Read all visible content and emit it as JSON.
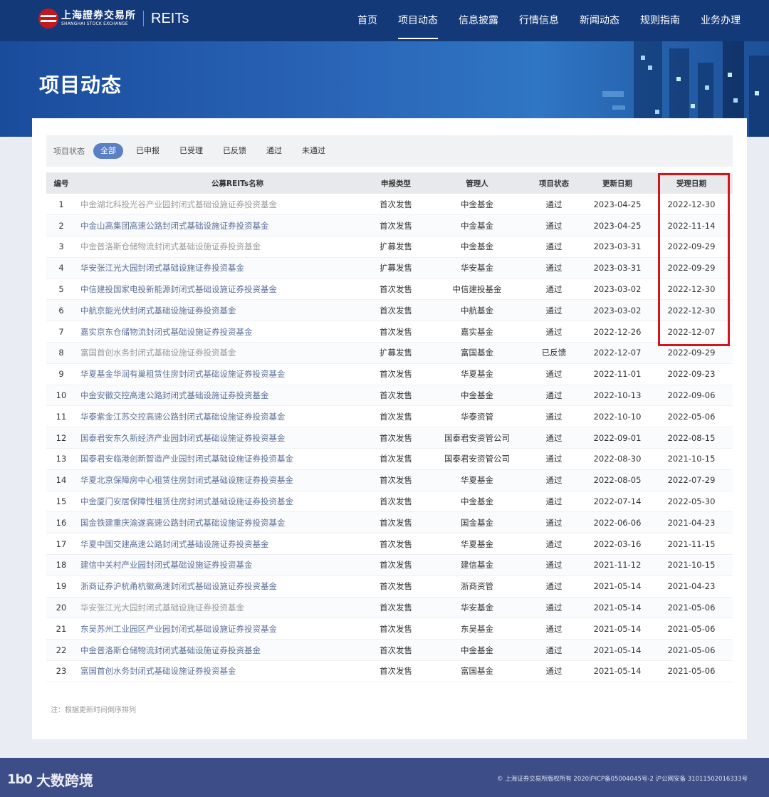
{
  "header": {
    "logo_cn": "上海證券交易所",
    "logo_en": "SHANGHAI STOCK EXCHANGE",
    "logo_reits": "REITs",
    "nav": [
      "首页",
      "项目动态",
      "信息披露",
      "行情信息",
      "新闻动态",
      "规则指南",
      "业务办理"
    ]
  },
  "banner": {
    "title": "项目动态"
  },
  "filter": {
    "label": "项目状态",
    "options": [
      "全部",
      "已申报",
      "已受理",
      "已反馈",
      "通过",
      "未通过"
    ],
    "active": "全部"
  },
  "table": {
    "headers": [
      "编号",
      "公募REITs名称",
      "申报类型",
      "管理人",
      "项目状态",
      "更新日期",
      "受理日期"
    ],
    "rows": [
      [
        "1",
        "中金湖北科投光谷产业园封闭式基础设施证券投资基金",
        "首次发售",
        "中金基金",
        "通过",
        "2023-04-25",
        "2022-12-30"
      ],
      [
        "2",
        "中金山高集团高速公路封闭式基础设施证券投资基金",
        "首次发售",
        "中金基金",
        "通过",
        "2023-04-25",
        "2022-11-14"
      ],
      [
        "3",
        "中金普洛斯仓储物流封闭式基础设施证券投资基金",
        "扩募发售",
        "中金基金",
        "通过",
        "2023-03-31",
        "2022-09-29"
      ],
      [
        "4",
        "华安张江光大园封闭式基础设施证券投资基金",
        "扩募发售",
        "华安基金",
        "通过",
        "2023-03-31",
        "2022-09-29"
      ],
      [
        "5",
        "中信建投国家电投新能源封闭式基础设施证券投资基金",
        "首次发售",
        "中信建投基金",
        "通过",
        "2023-03-02",
        "2022-12-30"
      ],
      [
        "6",
        "中航京能光伏封闭式基础设施证券投资基金",
        "首次发售",
        "中航基金",
        "通过",
        "2023-03-02",
        "2022-12-30"
      ],
      [
        "7",
        "嘉实京东仓储物流封闭式基础设施证券投资基金",
        "首次发售",
        "嘉实基金",
        "通过",
        "2022-12-26",
        "2022-12-07"
      ],
      [
        "8",
        "富国首创水务封闭式基础设施证券投资基金",
        "扩募发售",
        "富国基金",
        "已反馈",
        "2022-12-07",
        "2022-09-29"
      ],
      [
        "9",
        "华夏基金华润有巢租赁住房封闭式基础设施证券投资基金",
        "首次发售",
        "华夏基金",
        "通过",
        "2022-11-01",
        "2022-09-23"
      ],
      [
        "10",
        "中金安徽交控高速公路封闭式基础设施证券投资基金",
        "首次发售",
        "中金基金",
        "通过",
        "2022-10-13",
        "2022-09-06"
      ],
      [
        "11",
        "华泰紫金江苏交控高速公路封闭式基础设施证券投资基金",
        "首次发售",
        "华泰资管",
        "通过",
        "2022-10-10",
        "2022-05-06"
      ],
      [
        "12",
        "国泰君安东久新经济产业园封闭式基础设施证券投资基金",
        "首次发售",
        "国泰君安资管公司",
        "通过",
        "2022-09-01",
        "2022-08-15"
      ],
      [
        "13",
        "国泰君安临港创新智造产业园封闭式基础设施证券投资基金",
        "首次发售",
        "国泰君安资管公司",
        "通过",
        "2022-08-30",
        "2021-10-15"
      ],
      [
        "14",
        "华夏北京保障房中心租赁住房封闭式基础设施证券投资基金",
        "首次发售",
        "华夏基金",
        "通过",
        "2022-08-05",
        "2022-07-29"
      ],
      [
        "15",
        "中金厦门安居保障性租赁住房封闭式基础设施证券投资基金",
        "首次发售",
        "中金基金",
        "通过",
        "2022-07-14",
        "2022-05-30"
      ],
      [
        "16",
        "国金铁建重庆渝遂高速公路封闭式基础设施证券投资基金",
        "首次发售",
        "国金基金",
        "通过",
        "2022-06-06",
        "2021-04-23"
      ],
      [
        "17",
        "华夏中国交建高速公路封闭式基础设施证券投资基金",
        "首次发售",
        "华夏基金",
        "通过",
        "2022-03-16",
        "2021-11-15"
      ],
      [
        "18",
        "建信中关村产业园封闭式基础设施证券投资基金",
        "首次发售",
        "建信基金",
        "通过",
        "2021-11-12",
        "2021-10-15"
      ],
      [
        "19",
        "浙商证券沪杭甬杭徽高速封闭式基础设施证券投资基金",
        "首次发售",
        "浙商资管",
        "通过",
        "2021-05-14",
        "2021-04-23"
      ],
      [
        "20",
        "华安张江光大园封闭式基础设施证券投资基金",
        "首次发售",
        "华安基金",
        "通过",
        "2021-05-14",
        "2021-05-06"
      ],
      [
        "21",
        "东吴苏州工业园区产业园封闭式基础设施证券投资基金",
        "首次发售",
        "东吴基金",
        "通过",
        "2021-05-14",
        "2021-05-06"
      ],
      [
        "22",
        "中金普洛斯仓储物流封闭式基础设施证券投资基金",
        "首次发售",
        "中金基金",
        "通过",
        "2021-05-14",
        "2021-05-06"
      ],
      [
        "23",
        "富国首创水务封闭式基础设施证券投资基金",
        "首次发售",
        "富国基金",
        "通过",
        "2021-05-14",
        "2021-05-06"
      ]
    ],
    "gray_rows": [
      0,
      2,
      7,
      19
    ]
  },
  "note": "注：根据更新时间倒序排列",
  "footer": {
    "watermark_mark": "1b0",
    "watermark_text": "大数跨境",
    "copyright": "© 上海证券交易所版权所有 2020沪ICP备05004045号-2 沪公网安备 31011502016333号"
  },
  "colors": {
    "header_bg": "#143978",
    "filter_active": "#5b7fc4",
    "highlight_border": "#d8141b",
    "footer_bg": "#3c4d87"
  }
}
